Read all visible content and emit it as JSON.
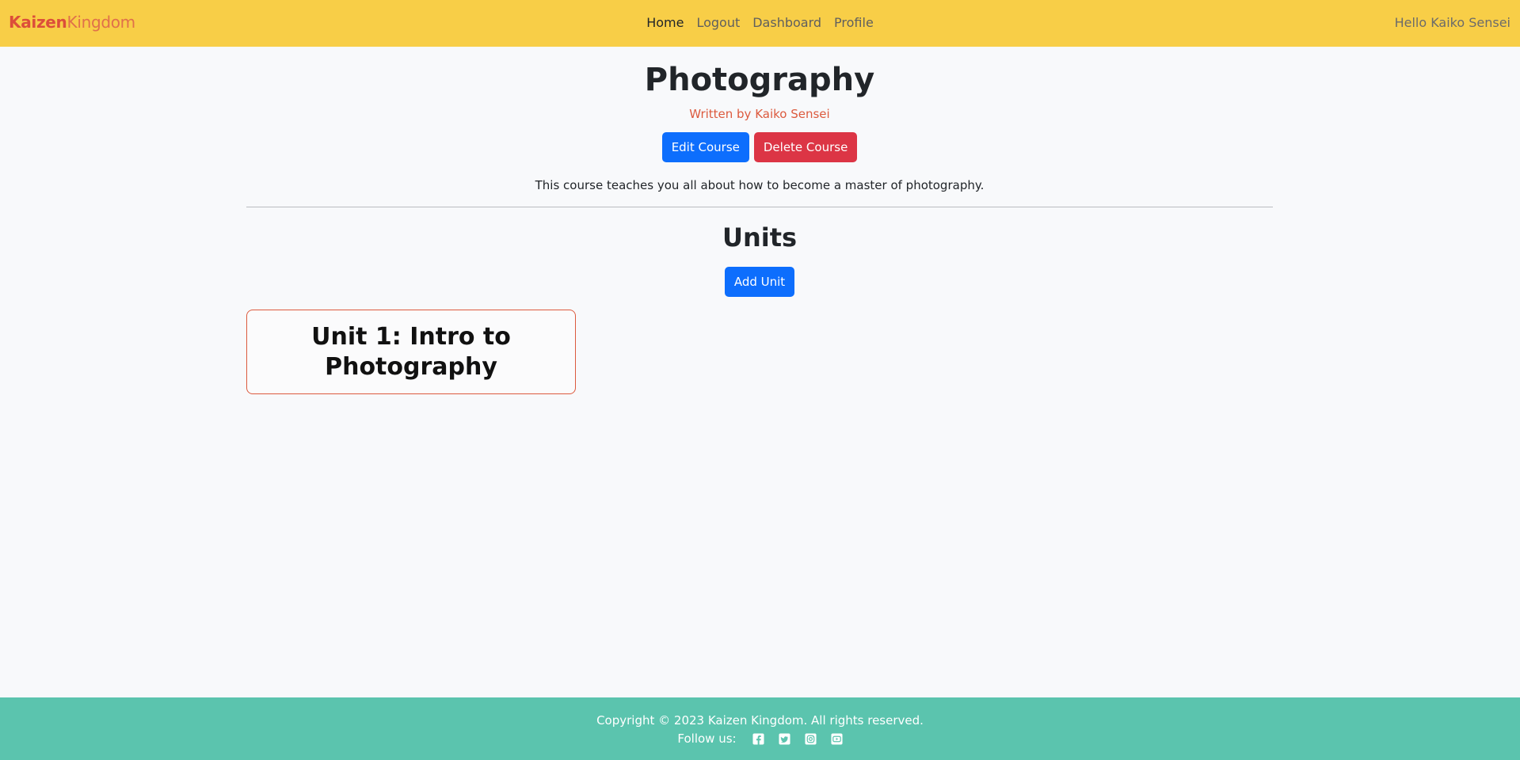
{
  "navbar": {
    "brand_primary": "Kaizen",
    "brand_secondary": "Kingdom",
    "links": [
      {
        "label": "Home",
        "active": true
      },
      {
        "label": "Logout",
        "active": false
      },
      {
        "label": "Dashboard",
        "active": false
      },
      {
        "label": "Profile",
        "active": false
      }
    ],
    "greeting": "Hello Kaiko Sensei",
    "bg_color": "#f8ce47"
  },
  "course": {
    "title": "Photography",
    "author": "Written by Kaiko Sensei",
    "edit_label": "Edit Course",
    "delete_label": "Delete Course",
    "description": "This course teaches you all about how to become a master of photography."
  },
  "units": {
    "heading": "Units",
    "add_label": "Add Unit",
    "items": [
      {
        "title": "Unit 1: Intro to Photography"
      }
    ]
  },
  "footer": {
    "copyright": "Copyright © 2023 Kaizen Kingdom. All rights reserved.",
    "follow_label": "Follow us:",
    "social_icons": [
      "facebook-icon",
      "twitter-icon",
      "instagram-icon",
      "youtube-icon"
    ],
    "bg_color": "#5bc4ae"
  },
  "colors": {
    "primary": "#0d6efd",
    "danger": "#dc3545",
    "accent": "#dc5a3e"
  }
}
